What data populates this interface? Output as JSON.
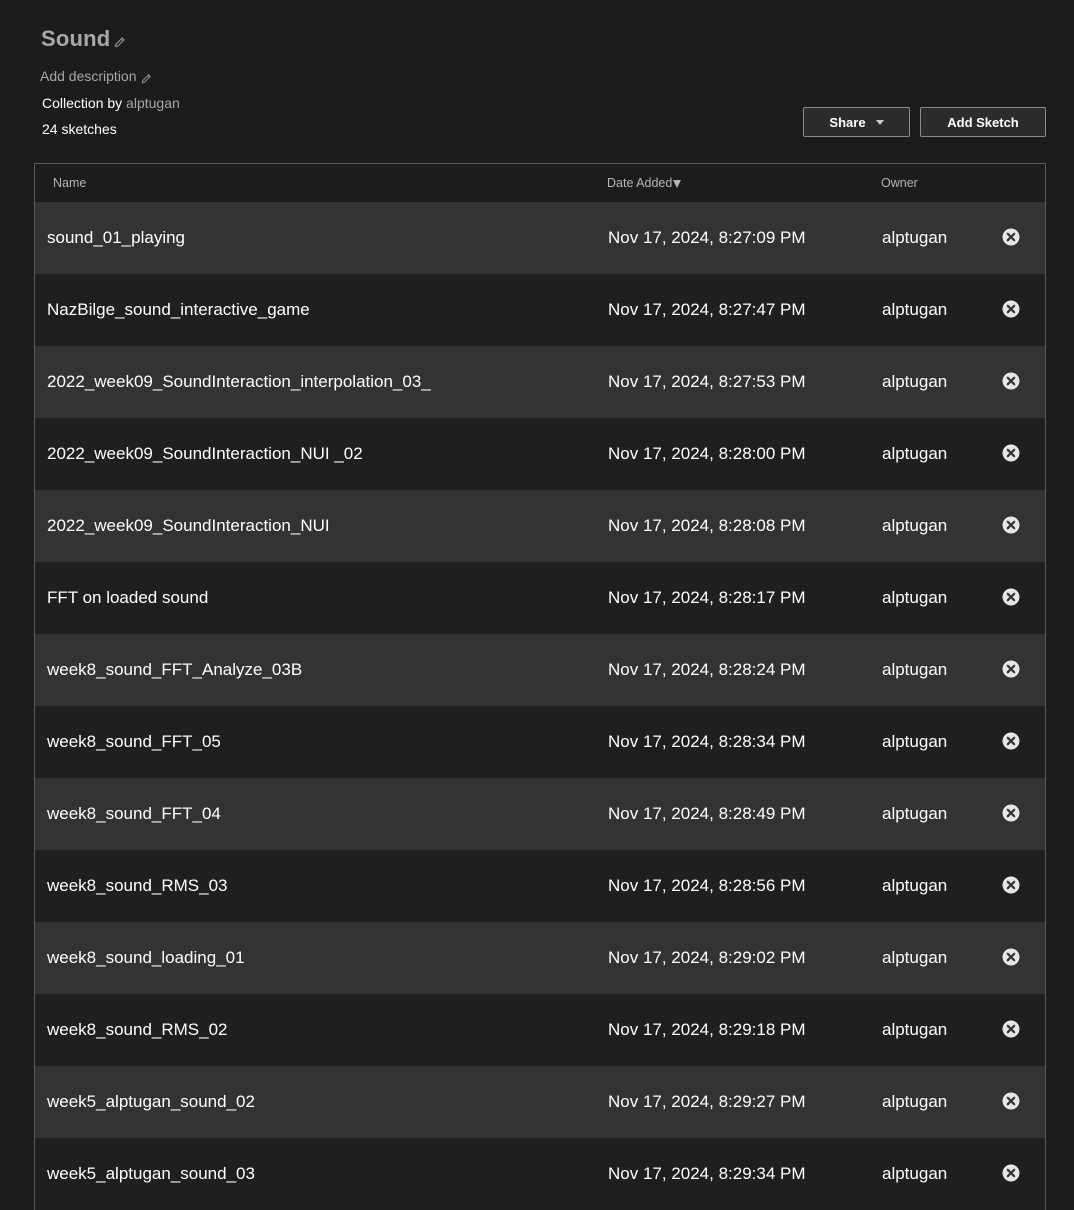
{
  "collection": {
    "title": "Sound",
    "description_placeholder": "Add description",
    "collection_by_label": "Collection by",
    "owner": "alptugan",
    "sketch_count": "24 sketches"
  },
  "toolbar": {
    "share_label": "Share",
    "add_sketch_label": "Add Sketch"
  },
  "table": {
    "headers": {
      "name": "Name",
      "date_added": "Date Added",
      "owner": "Owner"
    },
    "rows": [
      {
        "name": "sound_01_playing",
        "date": "Nov 17, 2024, 8:27:09 PM",
        "owner": "alptugan"
      },
      {
        "name": "NazBilge_sound_interactive_game",
        "date": "Nov 17, 2024, 8:27:47 PM",
        "owner": "alptugan"
      },
      {
        "name": "2022_week09_SoundInteraction_interpolation_03_",
        "date": "Nov 17, 2024, 8:27:53 PM",
        "owner": "alptugan"
      },
      {
        "name": "2022_week09_SoundInteraction_NUI _02",
        "date": "Nov 17, 2024, 8:28:00 PM",
        "owner": "alptugan"
      },
      {
        "name": "2022_week09_SoundInteraction_NUI",
        "date": "Nov 17, 2024, 8:28:08 PM",
        "owner": "alptugan"
      },
      {
        "name": "FFT on loaded sound",
        "date": "Nov 17, 2024, 8:28:17 PM",
        "owner": "alptugan"
      },
      {
        "name": "week8_sound_FFT_Analyze_03B",
        "date": "Nov 17, 2024, 8:28:24 PM",
        "owner": "alptugan"
      },
      {
        "name": "week8_sound_FFT_05",
        "date": "Nov 17, 2024, 8:28:34 PM",
        "owner": "alptugan"
      },
      {
        "name": "week8_sound_FFT_04",
        "date": "Nov 17, 2024, 8:28:49 PM",
        "owner": "alptugan"
      },
      {
        "name": "week8_sound_RMS_03",
        "date": "Nov 17, 2024, 8:28:56 PM",
        "owner": "alptugan"
      },
      {
        "name": "week8_sound_loading_01",
        "date": "Nov 17, 2024, 8:29:02 PM",
        "owner": "alptugan"
      },
      {
        "name": "week8_sound_RMS_02",
        "date": "Nov 17, 2024, 8:29:18 PM",
        "owner": "alptugan"
      },
      {
        "name": "week5_alptugan_sound_02",
        "date": "Nov 17, 2024, 8:29:27 PM",
        "owner": "alptugan"
      },
      {
        "name": "week5_alptugan_sound_03",
        "date": "Nov 17, 2024, 8:29:34 PM",
        "owner": "alptugan"
      }
    ]
  },
  "icons": {
    "edit": "pencil-icon",
    "remove": "close-circle-icon",
    "sort": "sort-descending-icon",
    "dropdown": "chevron-down-icon"
  },
  "colors": {
    "background": "#1c1c1c",
    "row_alt": "#333333",
    "row": "#1f1f1f",
    "muted_text": "#a6a6a6"
  }
}
